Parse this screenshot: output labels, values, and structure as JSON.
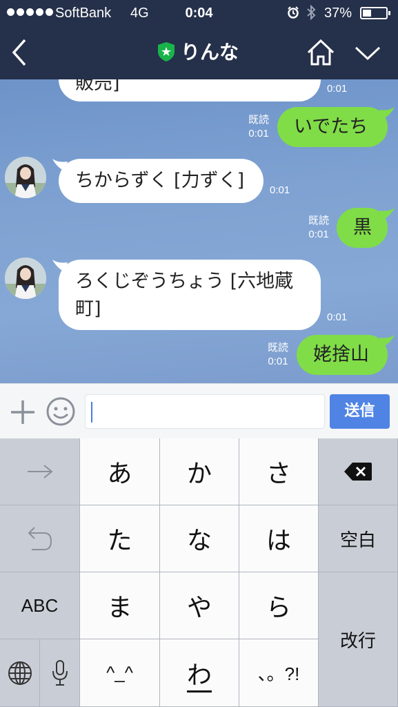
{
  "status": {
    "carrier": "SoftBank",
    "network": "4G",
    "time": "0:04",
    "battery_pct": "37%",
    "battery_level": 0.37
  },
  "nav": {
    "title": "りんな",
    "back_icon": "chevron-left-icon",
    "home_icon": "home-icon",
    "menu_icon": "chevron-down-icon",
    "shield_color": "#19b34a"
  },
  "messages": [
    {
      "side": "in",
      "text": "販売]",
      "time": "0:01",
      "avatar": false
    },
    {
      "side": "out",
      "text": "いでたち",
      "read": "既読",
      "time": "0:01"
    },
    {
      "side": "in",
      "text": "ちからずく [力ずく]",
      "time": "0:01",
      "avatar": true
    },
    {
      "side": "out",
      "text": "黒",
      "read": "既読",
      "time": "0:01"
    },
    {
      "side": "in",
      "text": "ろくじぞうちょう [六地蔵",
      "text2": "町]",
      "time": "0:01",
      "avatar": true
    },
    {
      "side": "out",
      "text": "姥捨山",
      "read": "既読",
      "time": "0:01"
    }
  ],
  "input": {
    "placeholder": "",
    "value": "",
    "send_label": "送信"
  },
  "keyboard": {
    "rows": [
      [
        "→",
        "あ",
        "か",
        "さ",
        "⌫"
      ],
      [
        "↺",
        "た",
        "な",
        "は",
        "空白"
      ],
      [
        "ABC",
        "ま",
        "や",
        "ら",
        "改行"
      ],
      [
        "🌐",
        "🎤",
        "^_^",
        "わ_",
        "、。?!"
      ]
    ],
    "space_label": "空白",
    "enter_label": "改行",
    "abc_label": "ABC",
    "kaomoji_label": "^_^",
    "wa_label": "わ",
    "punct_label": "、。?!"
  },
  "colors": {
    "header": "#25304a",
    "out_bubble": "#80dd48",
    "in_bubble": "#ffffff",
    "send_button": "#4f84e5"
  }
}
